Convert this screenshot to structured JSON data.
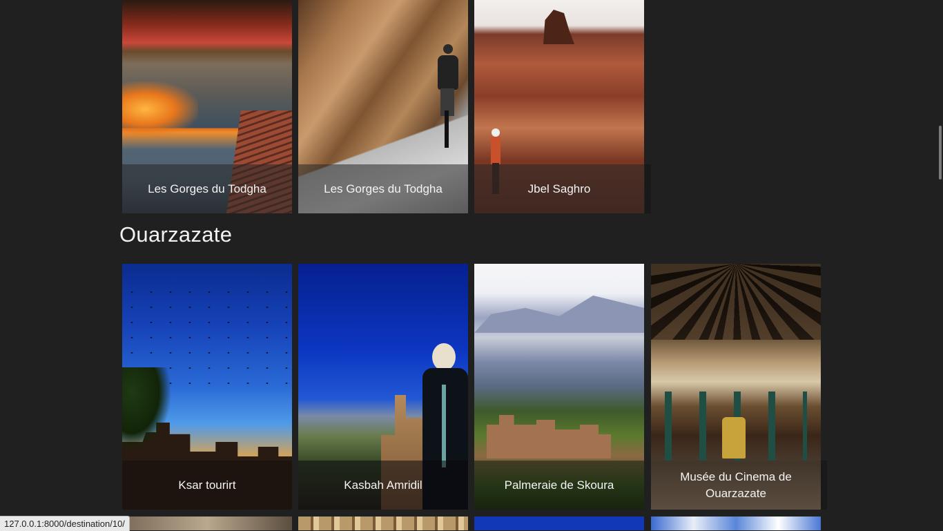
{
  "top_row": [
    {
      "caption": "Les Gorges du Todgha",
      "image": "riverbed-hotel-photo"
    },
    {
      "caption": "Les Gorges du Todgha",
      "image": "cyclist-gorge-photo"
    },
    {
      "caption": "Jbel Saghro",
      "image": "desert-mountain-photo"
    }
  ],
  "section": {
    "title": "Ouarzazate"
  },
  "ouarzazate_cards": [
    {
      "caption": "Ksar tourirt",
      "image": "kasbah-birds-sky-photo"
    },
    {
      "caption": "Kasbah Amridil",
      "image": "woman-kasbah-photo"
    },
    {
      "caption": "Palmeraie de Skoura",
      "image": "palm-grove-mountains-photo"
    },
    {
      "caption": "Musée du Cinema de Ouarzazate",
      "image": "cinema-museum-interior-photo"
    }
  ],
  "status_bar": {
    "url": "127.0.0.1:8000/destination/10/"
  }
}
